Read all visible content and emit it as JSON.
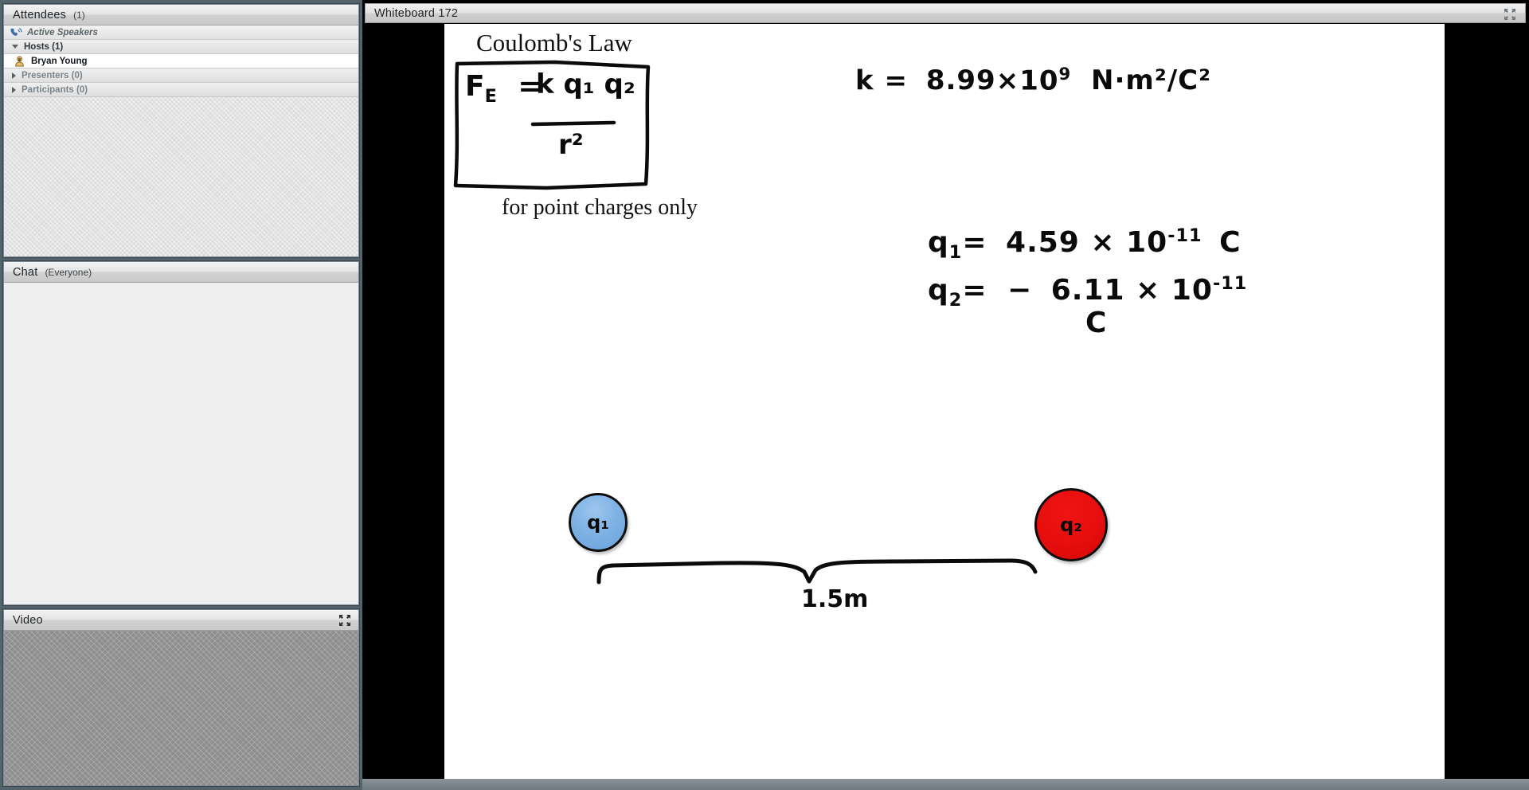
{
  "sidebar": {
    "attendees": {
      "title": "Attendees",
      "count": "(1)",
      "active_speakers_label": "Active Speakers",
      "active_speakers_icon": "phone-speaker-icon",
      "groups": [
        {
          "label": "Hosts (1)",
          "expanded": true,
          "icon": "triangle-down-icon",
          "members": [
            {
              "name": "Bryan Young",
              "icon": "host-badge-icon"
            }
          ]
        },
        {
          "label": "Presenters (0)",
          "expanded": false,
          "icon": "triangle-right-icon",
          "members": []
        },
        {
          "label": "Participants (0)",
          "expanded": false,
          "icon": "triangle-right-icon",
          "members": []
        }
      ]
    },
    "chat": {
      "title": "Chat",
      "scope": "(Everyone)",
      "messages": []
    },
    "video": {
      "title": "Video",
      "expand_icon": "expand-arrows-icon"
    }
  },
  "main": {
    "whiteboard": {
      "title": "Whiteboard 172",
      "expand_icon": "expand-arrows-icon",
      "content": {
        "heading": "Coulomb's Law",
        "formula": {
          "left": "F",
          "left_sub": "E",
          "equals": "=",
          "numerator": "k q₁ q₂",
          "denominator": "r²"
        },
        "note": "for point charges only",
        "constant": {
          "symbol": "k",
          "equals": "=",
          "mantissa": "8.99",
          "times": "×",
          "base": "10",
          "exponent": "9",
          "units": "N·m²/C²"
        },
        "charges": [
          {
            "symbol": "q",
            "index": "1",
            "equals": "=",
            "value": "4.59",
            "times": "×",
            "base": "10",
            "exponent": "-11",
            "unit": "C",
            "sign": ""
          },
          {
            "symbol": "q",
            "index": "2",
            "equals": "=",
            "value": "6.11",
            "times": "×",
            "base": "10",
            "exponent": "-11",
            "unit": "C",
            "sign": "−"
          }
        ],
        "diagram": {
          "charge_left": {
            "label": "q₁",
            "color": "#7fb2e4"
          },
          "charge_right": {
            "label": "q₂",
            "color": "#e60e0e"
          },
          "distance_label": "1.5m"
        }
      }
    }
  },
  "colors": {
    "chrome": "#d4d4d4",
    "sidebar_bg": "#55636c",
    "stage_bg": "#000000",
    "canvas_bg": "#ffffff",
    "accent_blue": "#7fb2e4",
    "accent_red": "#e60e0e"
  }
}
